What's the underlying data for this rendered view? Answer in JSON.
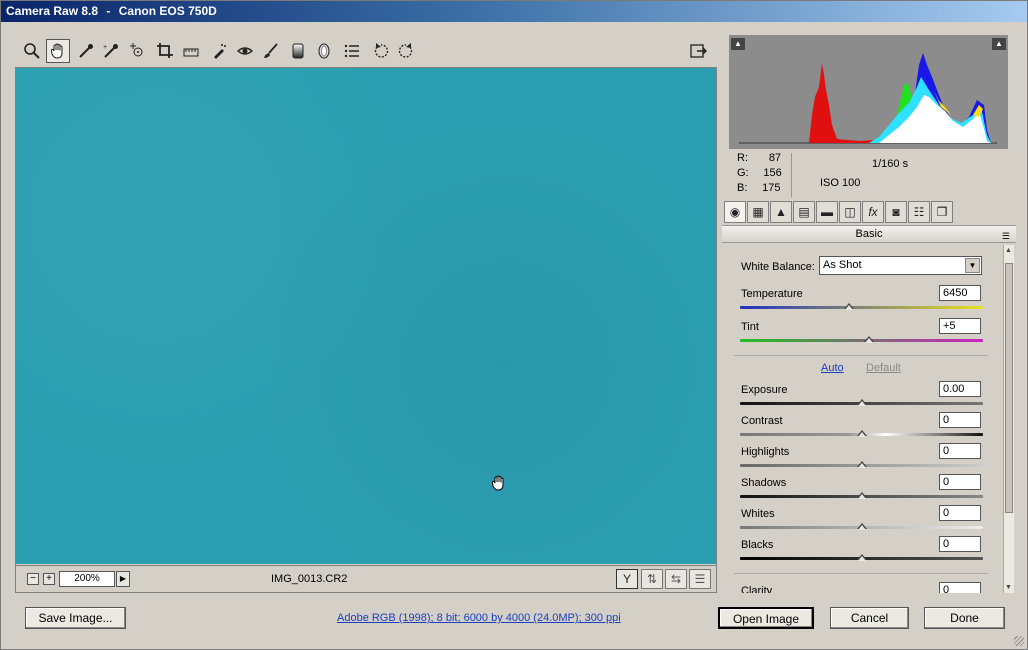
{
  "window": {
    "app": "Camera Raw 8.8",
    "separator": "-",
    "camera": "Canon EOS 750D"
  },
  "toolbar": {
    "tools": [
      "zoom-tool",
      "hand-tool",
      "white-balance-tool",
      "color-sampler-tool",
      "targeted-adjustment-tool",
      "crop-tool",
      "straighten-tool",
      "spot-removal-tool",
      "red-eye-tool",
      "adjustment-brush-tool",
      "graduated-filter-tool",
      "radial-filter-tool",
      "preferences-tool",
      "rotate-ccw-tool",
      "rotate-cw-tool"
    ],
    "active_tool": "hand-tool"
  },
  "preview": {
    "color": "#2b9fb1"
  },
  "status": {
    "zoom": "200%",
    "filename": "IMG_0013.CR2"
  },
  "readout": {
    "r_label": "R:",
    "r_value": "87",
    "g_label": "G:",
    "g_value": "156",
    "b_label": "B:",
    "b_value": "175",
    "shutter": "1/160 s",
    "iso": "ISO 100"
  },
  "panel": {
    "title": "Basic",
    "wb_label": "White Balance:",
    "wb_value": "As Shot",
    "auto": "Auto",
    "default": "Default",
    "sliders": [
      {
        "label": "Temperature",
        "value": "6450",
        "position": 0.45
      },
      {
        "label": "Tint",
        "value": "+5",
        "position": 0.53
      },
      {
        "label": "Exposure",
        "value": "0.00",
        "position": 0.5
      },
      {
        "label": "Contrast",
        "value": "0",
        "position": 0.5
      },
      {
        "label": "Highlights",
        "value": "0",
        "position": 0.5
      },
      {
        "label": "Shadows",
        "value": "0",
        "position": 0.5
      },
      {
        "label": "Whites",
        "value": "0",
        "position": 0.5
      },
      {
        "label": "Blacks",
        "value": "0",
        "position": 0.5
      }
    ],
    "clarity_label": "Clarity",
    "clarity_value": "0"
  },
  "buttons": {
    "save": "Save Image...",
    "workflow": "Adobe RGB (1998); 8 bit; 6000 by 4000 (24.0MP); 300 ppi",
    "open": "Open Image",
    "cancel": "Cancel",
    "done": "Done"
  }
}
